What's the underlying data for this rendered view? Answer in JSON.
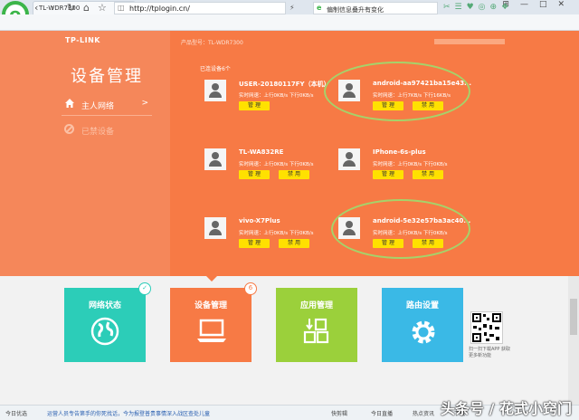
{
  "browser": {
    "tab_title": "TL-WDR7300",
    "url": "http://tplogin.cn/",
    "search_text": "偏制信息叠升有变化",
    "window_controls": [
      "⊞",
      "—",
      "□",
      "✕"
    ]
  },
  "router": {
    "brand": "TP-LINK",
    "model": "产品型号：TL-WDR7300",
    "page_title": "设备管理",
    "sidebar": [
      {
        "label": "主人网络",
        "chevron": ">"
      },
      {
        "label": "已禁设备"
      }
    ],
    "connected": "已连设备6个",
    "devices": [
      {
        "name": "USER-20180117FY（本机）",
        "speed": "实时网速：上行0KB/s 下行0KB/s",
        "btn1": "管 理",
        "btn2": ""
      },
      {
        "name": "android-aa97421ba15e43...",
        "speed": "实时网速：上行7KB/s 下行16KB/s",
        "btn1": "管 理",
        "btn2": "禁 用"
      },
      {
        "name": "TL-WA832RE",
        "speed": "实时网速：上行0KB/s 下行0KB/s",
        "btn1": "管 理",
        "btn2": "禁 用"
      },
      {
        "name": "IPhone-6s-plus",
        "speed": "实时网速：上行0KB/s 下行0KB/s",
        "btn1": "管 理",
        "btn2": "禁 用"
      },
      {
        "name": "vivo-X7Plus",
        "speed": "实时网速：上行0KB/s 下行0KB/s",
        "btn1": "管 理",
        "btn2": "禁 用"
      },
      {
        "name": "android-5e32e57ba3ac40...",
        "speed": "实时网速：上行0KB/s 下行0KB/s",
        "btn1": "管 理",
        "btn2": "禁 用"
      }
    ],
    "tiles": [
      {
        "label": "网络状态",
        "color": "#2ccdb8"
      },
      {
        "label": "设备管理",
        "color": "#f77a45",
        "badge": "6"
      },
      {
        "label": "应用管理",
        "color": "#9bd03b"
      },
      {
        "label": "路由设置",
        "color": "#3ab9e6"
      }
    ],
    "qr_text": "扫一扫下载APP 获取更多新功能"
  },
  "status": {
    "left": "今日优选",
    "news": "运营人员专告第手的你死找话，今为报登普贵事情深入战区查处儿童",
    "items": [
      "快剪辑",
      "今日直播",
      "热点资讯",
      "下载"
    ]
  },
  "watermark": "头条号 / 花式小窍门"
}
